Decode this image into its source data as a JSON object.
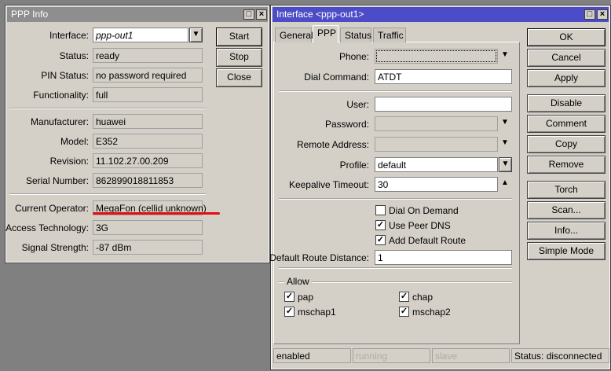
{
  "ppp_info": {
    "title": "PPP Info",
    "labels": {
      "interface": "Interface:",
      "status": "Status:",
      "pin_status": "PIN Status:",
      "functionality": "Functionality:",
      "manufacturer": "Manufacturer:",
      "model": "Model:",
      "revision": "Revision:",
      "serial": "Serial Number:",
      "operator": "Current Operator:",
      "access_tech": "Access Technology:",
      "signal": "Signal Strength:"
    },
    "values": {
      "interface": "ppp-out1",
      "status": "ready",
      "pin_status": "no password required",
      "functionality": "full",
      "manufacturer": "huawei",
      "model": "E352",
      "revision": "11.102.27.00.209",
      "serial": "862899018811853",
      "operator": "MegaFon (cellid unknown)",
      "access_tech": "3G",
      "signal": "-87 dBm"
    },
    "buttons": {
      "start": "Start",
      "stop": "Stop",
      "close": "Close"
    },
    "highlight_color": "#e01010"
  },
  "interface": {
    "title": "Interface <ppp-out1>",
    "tabs": [
      "General",
      "PPP",
      "Status",
      "Traffic"
    ],
    "active_tab": "PPP",
    "labels": {
      "phone": "Phone:",
      "dial": "Dial Command:",
      "user": "User:",
      "password": "Password:",
      "remote": "Remote Address:",
      "profile": "Profile:",
      "keepalive": "Keepalive Timeout:",
      "drd": "Default Route Distance:"
    },
    "values": {
      "phone": "",
      "dial": "ATDT",
      "user": "",
      "password": "",
      "remote": "",
      "profile": "default",
      "keepalive": "30",
      "drd": "1"
    },
    "checks": [
      {
        "label": "Dial On Demand",
        "checked": false
      },
      {
        "label": "Use Peer DNS",
        "checked": true
      },
      {
        "label": "Add Default Route",
        "checked": true
      }
    ],
    "allow": {
      "title": "Allow",
      "items": [
        {
          "label": "pap",
          "checked": true
        },
        {
          "label": "chap",
          "checked": true
        },
        {
          "label": "mschap1",
          "checked": true
        },
        {
          "label": "mschap2",
          "checked": true
        }
      ]
    },
    "buttons": [
      "OK",
      "Cancel",
      "Apply",
      "Disable",
      "Comment",
      "Copy",
      "Remove",
      "Torch",
      "Scan...",
      "Info...",
      "Simple Mode"
    ],
    "statusbar": [
      "enabled",
      "running",
      "slave",
      "Status: disconnected"
    ]
  }
}
